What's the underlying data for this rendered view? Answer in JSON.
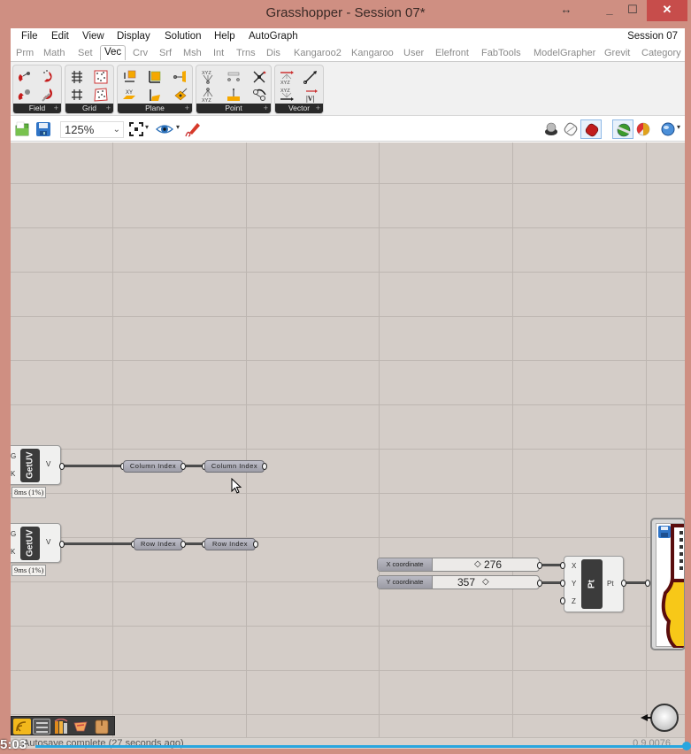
{
  "window": {
    "title": "Grasshopper - Session 07*",
    "controls": {
      "resize": "↔",
      "minimize": "_",
      "maximize": "☐",
      "close": "✕"
    }
  },
  "menubar": {
    "items": [
      "File",
      "Edit",
      "View",
      "Display",
      "Solution",
      "Help",
      "AutoGraph"
    ],
    "session_label": "Session 07"
  },
  "tabs": {
    "items": [
      "Prm",
      "Math",
      "Set",
      "Vec",
      "Crv",
      "Srf",
      "Msh",
      "Int",
      "Trns",
      "Dis",
      "Kangaroo2",
      "Kangaroo",
      "User",
      "Elefront",
      "FabTools",
      "ModelGrapher",
      "Grevit",
      "Category"
    ],
    "active": "Vec"
  },
  "ribbon": {
    "groups": [
      {
        "label": "Field",
        "plus": "+"
      },
      {
        "label": "Grid",
        "plus": "+"
      },
      {
        "label": "Plane",
        "plus": "+"
      },
      {
        "label": "Point",
        "plus": "+"
      },
      {
        "label": "Vector",
        "plus": "+"
      }
    ]
  },
  "toolbar": {
    "zoom_level": "125%",
    "zoom_caret": "⌄",
    "dropdown_caret": "▾"
  },
  "canvas": {
    "getuv_1": {
      "name": "GetUV",
      "inputs": [
        "G",
        "K"
      ],
      "output": "V",
      "timer": "8ms (1%)"
    },
    "getuv_2": {
      "name": "GetUV",
      "inputs": [
        "G",
        "K"
      ],
      "output": "V",
      "timer": "9ms (1%)"
    },
    "params": {
      "column_index_1": "Column Index",
      "column_index_2": "Column Index",
      "row_index_1": "Row Index",
      "row_index_2": "Row Index"
    },
    "sliders": {
      "x": {
        "label": "X coordinate",
        "value": "276",
        "marker": "◇"
      },
      "y": {
        "label": "Y coordinate",
        "value": "357",
        "marker": "◇"
      }
    },
    "point_component": {
      "name": "Pt",
      "inputs": [
        "X",
        "Y",
        "Z"
      ],
      "output": "Pt"
    }
  },
  "status": {
    "message": "Autosave complete (27 seconds ago)",
    "version": "0.9.0076",
    "video_time": "5:03"
  },
  "colors": {
    "title_bar": "#cf8f82",
    "close_button": "#c74d4b",
    "canvas": "#d4cdc8",
    "progress": "#29a6df"
  }
}
